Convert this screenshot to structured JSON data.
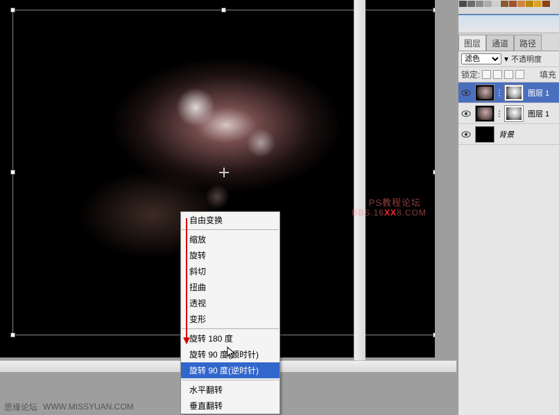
{
  "swatch_colors": [
    "#4a4a4a",
    "#6b6b6b",
    "#8c8c8c",
    "#adadad",
    "#cecece",
    "#8b5a2b",
    "#a0522d",
    "#cd853f",
    "#b8860b",
    "#daa520",
    "#8b4513"
  ],
  "context_menu": {
    "free_transform": "自由变换",
    "scale": "缩放",
    "rotate": "旋转",
    "skew": "斜切",
    "distort": "扭曲",
    "perspective": "透视",
    "warp": "变形",
    "rotate_180": "旋转 180 度",
    "rotate_90_cw": "旋转 90 度(顺时针)",
    "rotate_90_ccw": "旋转 90 度(逆时针)",
    "flip_h": "水平翻转",
    "flip_v": "垂直翻转"
  },
  "layers_panel": {
    "tabs": {
      "layers": "图层",
      "channels": "通道",
      "paths": "路径"
    },
    "blend_mode": "滤色",
    "opacity_label": "不透明度",
    "lock_label": "锁定:",
    "fill_label": "填充",
    "layers": [
      {
        "name": "图层 1",
        "selected": true
      },
      {
        "name": "图层 1",
        "selected": false
      },
      {
        "name": "背景",
        "selected": false,
        "is_bg": true
      }
    ]
  },
  "footer": {
    "site_label": "思缘论坛",
    "site_url": "WWW.MISSYUAN.COM"
  },
  "watermark": {
    "line1": "PS教程论坛",
    "line2_pre": "BBS.16",
    "line2_xx": "XX",
    "line2_post": "8.COM"
  }
}
